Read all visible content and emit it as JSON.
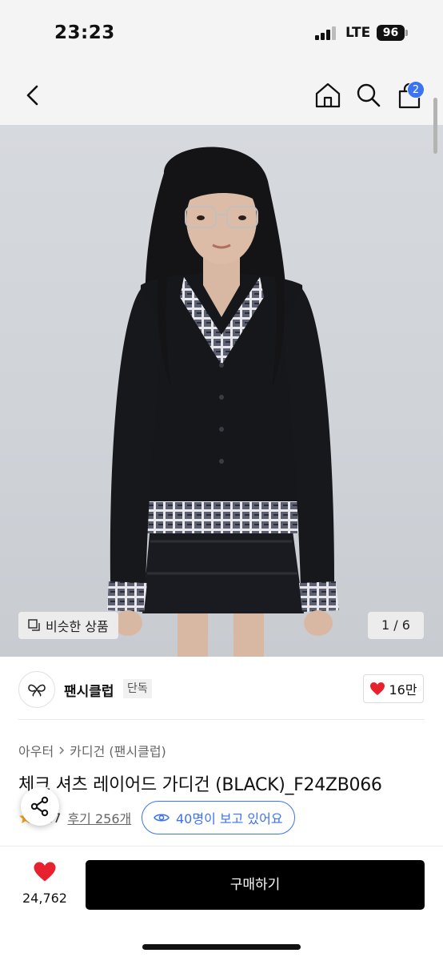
{
  "status_bar": {
    "time": "23:23",
    "network": "LTE",
    "battery": "96"
  },
  "nav": {
    "cart_count": "2",
    "icons": [
      "back-icon",
      "home-icon",
      "search-icon",
      "shopping-bag-icon"
    ]
  },
  "gallery": {
    "similar_label": "비슷한 상품",
    "counter": "1 / 6"
  },
  "brand": {
    "name": "팬시클럽",
    "badge": "단독",
    "likes": "16만"
  },
  "product": {
    "breadcrumb": [
      "아우터",
      "카디건 (팬시클럽)"
    ],
    "title": "체크 셔츠 레이어드 가디건 (BLACK)_F24ZB066",
    "rating": "4.7",
    "review_label": "후기 256개",
    "viewers": "40명이 보고 있어요"
  },
  "bottom_bar": {
    "wish_count": "24,762",
    "buy_label": "구매하기"
  },
  "colors": {
    "accent": "#3b73f0",
    "heart": "#e8212e",
    "buy_button": "#000000",
    "star": "#f5a623"
  }
}
